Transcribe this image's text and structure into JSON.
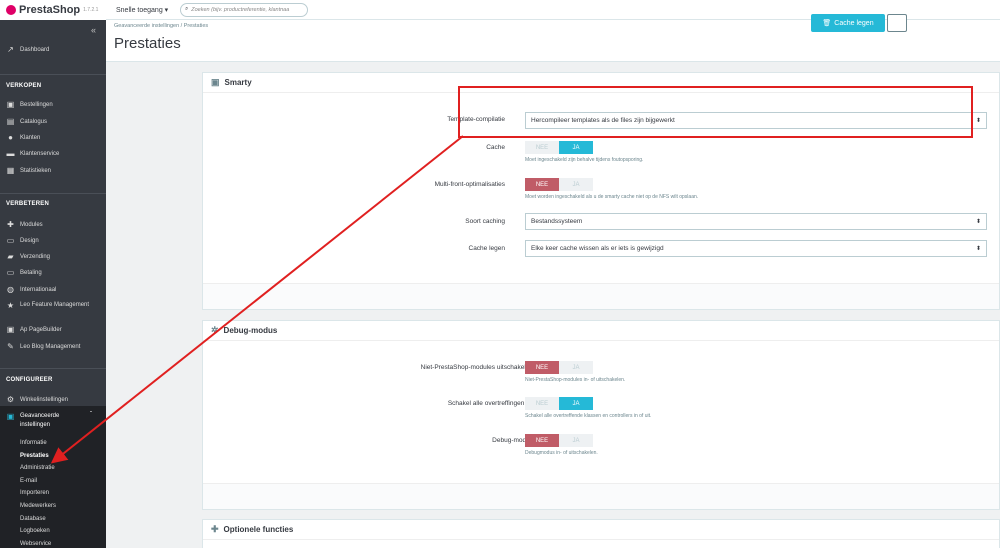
{
  "app": {
    "name": "PrestaShop",
    "version": "1.7.2.1"
  },
  "topbar": {
    "quick_access": "Snelle toegang ▾",
    "search_placeholder": "Zoeken (bijv. productreferentie, klantnaa"
  },
  "sidebar": {
    "collapse": "«",
    "dashboard": "Dashboard",
    "sections": [
      {
        "title": "VERKOPEN",
        "items": [
          "Bestellingen",
          "Catalogus",
          "Klanten",
          "Klantenservice",
          "Statistieken"
        ]
      },
      {
        "title": "VERBETEREN",
        "items": [
          "Modules",
          "Design",
          "Verzending",
          "Betaling",
          "Internationaal",
          "Leo Feature Management",
          "Ap PageBuilder",
          "Leo Blog Management"
        ]
      },
      {
        "title": "CONFIGUREER",
        "items": [
          "Winkelinstellingen",
          "Geavanceerde instellingen"
        ]
      }
    ],
    "subitems": [
      "Informatie",
      "Prestaties",
      "Administratie",
      "E-mail",
      "Importeren",
      "Medewerkers",
      "Database",
      "Logboeken",
      "Webservice"
    ],
    "active_subitem": "Prestaties"
  },
  "header": {
    "breadcrumb": "Geavanceerde instellingen  /  Prestaties",
    "title": "Prestaties",
    "clear_cache_label": "Cache legen"
  },
  "smarty": {
    "title": "Smarty",
    "template_label": "Template-compilatie",
    "template_value": "Hercompileer templates als de files zijn bijgewerkt",
    "cache_label": "Cache",
    "cache_help": "Moet ingeschakeld zijn behalve tijdens foutopsporing.",
    "multifront_label": "Multi-front-optimalisaties",
    "multifront_help": "Moet worden ingeschakeld als u de smarty cache niet op de NFS wilt opslaan.",
    "caching_type_label": "Soort caching",
    "caching_type_value": "Bestandssysteem",
    "clear_cache_label": "Cache legen",
    "clear_cache_value": "Elke keer cache wissen als er iets is gewijzigd"
  },
  "debug": {
    "title": "Debug-modus",
    "nonps_label": "Niet-PrestaShop-modules uitschakelen",
    "nonps_help": "Niet-PrestaShop-modules in- of uitschakelen.",
    "overrides_label": "Schakel alle overtreffingen uit",
    "overrides_help": "Schakel alle overtreffende klassen en controllers in of uit.",
    "debug_label": "Debug-modus",
    "debug_help": "Debugmodus in- of uitschakelen."
  },
  "optional": {
    "title": "Optionele functies"
  },
  "toggle": {
    "no": "NEE",
    "yes": "JA"
  },
  "colors": {
    "accent": "#25b9d7",
    "no_active": "#c05c67",
    "annotation": "#e02020",
    "sidebar": "#363a41"
  }
}
